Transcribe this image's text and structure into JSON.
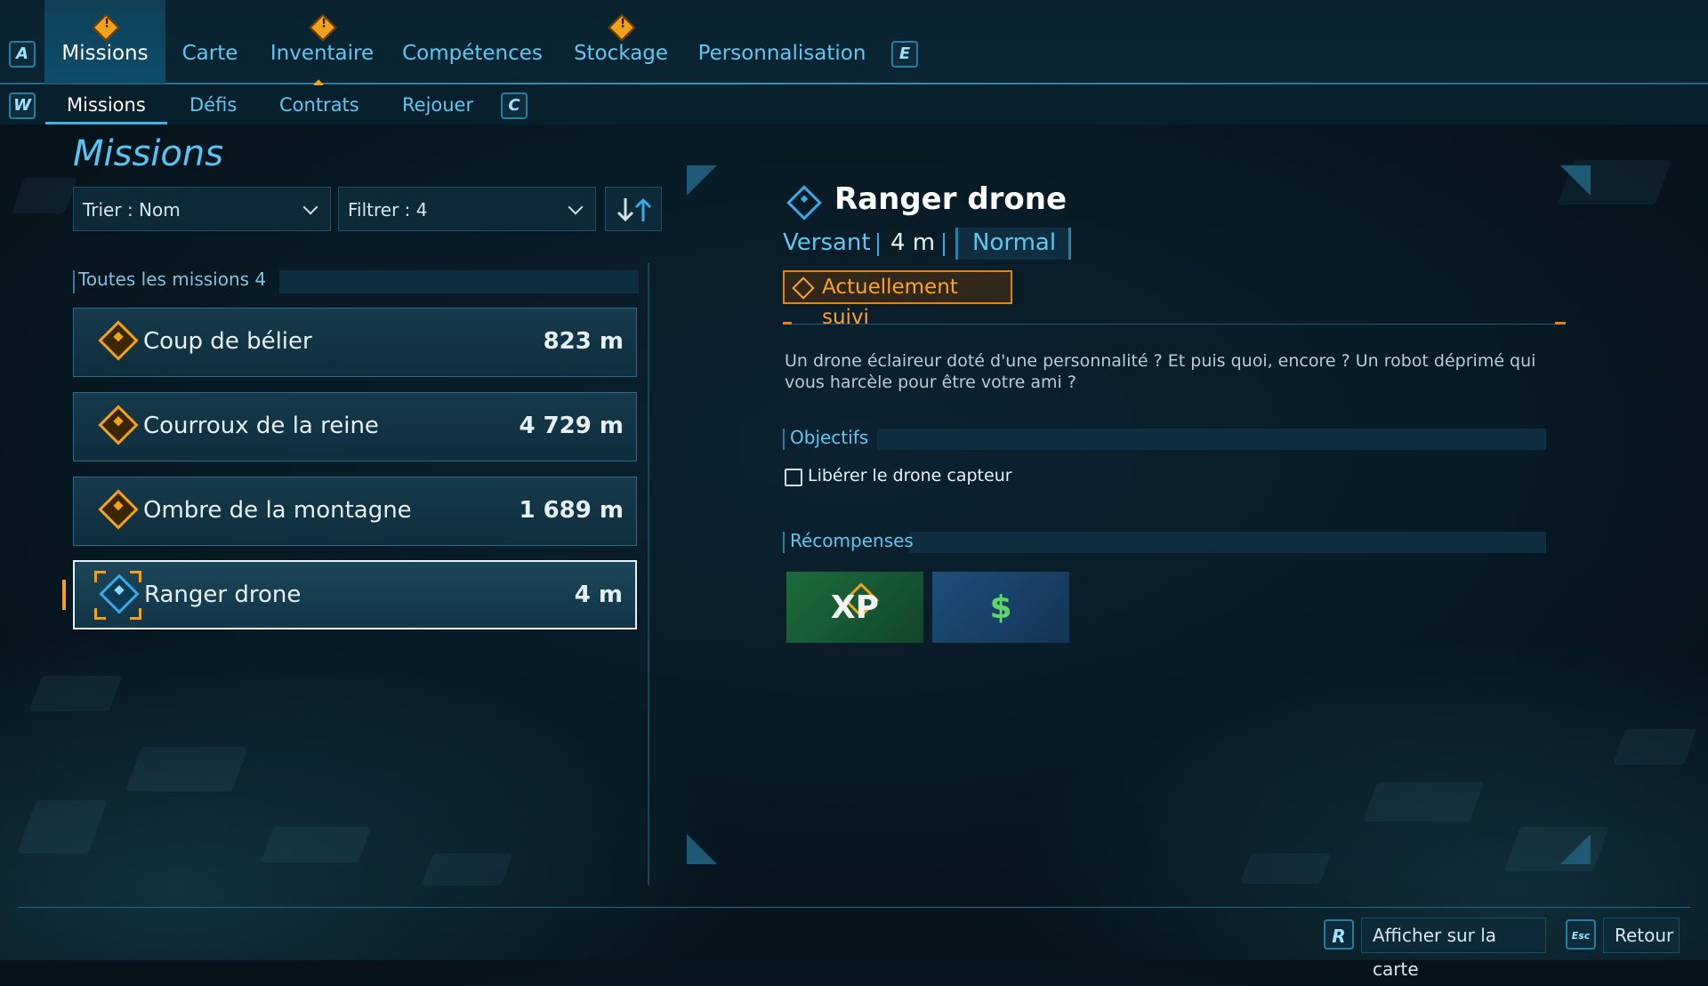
{
  "top_tabs": {
    "left_key": "A",
    "right_key": "E",
    "items": [
      {
        "label": "Missions",
        "active": true,
        "alert": true
      },
      {
        "label": "Carte",
        "active": false,
        "alert": false
      },
      {
        "label": "Inventaire",
        "active": false,
        "alert": true
      },
      {
        "label": "Compétences",
        "active": false,
        "alert": false
      },
      {
        "label": "Stockage",
        "active": false,
        "alert": true
      },
      {
        "label": "Personnalisation",
        "active": false,
        "alert": false
      }
    ]
  },
  "sub_tabs": {
    "left_key": "W",
    "right_key": "C",
    "items": [
      {
        "label": "Missions",
        "active": true
      },
      {
        "label": "Défis",
        "active": false
      },
      {
        "label": "Contrats",
        "active": false
      },
      {
        "label": "Rejouer",
        "active": false
      }
    ]
  },
  "left_panel": {
    "title": "Missions",
    "sort_label": "Trier : Nom",
    "filter_label": "Filtrer : 4",
    "group_label": "Toutes les missions 4",
    "missions": [
      {
        "name": "Coup de bélier",
        "distance": "823 m",
        "icon": "mission-alert-icon",
        "selected": false
      },
      {
        "name": "Courroux de la reine",
        "distance": "4 729 m",
        "icon": "mission-alert-icon",
        "selected": false
      },
      {
        "name": "Ombre de la montagne",
        "distance": "1 689 m",
        "icon": "mission-alert-icon",
        "selected": false
      },
      {
        "name": "Ranger drone",
        "distance": "4 m",
        "icon": "tracked-mission-icon",
        "selected": true
      }
    ]
  },
  "detail": {
    "title": "Ranger drone",
    "location": "Versant",
    "distance": "4 m",
    "difficulty": "Normal",
    "tracked_label": "Actuellement suivi",
    "description": "Un drone éclaireur doté d'une personnalité ? Et puis quoi, encore ? Un robot déprimé qui vous harcèle pour être votre ami ?",
    "objectives_label": "Objectifs",
    "objectives": [
      "Libérer le drone capteur"
    ],
    "rewards_label": "Récompenses",
    "rewards": [
      {
        "label": "XP",
        "icon": "xp-reward-icon"
      },
      {
        "label": "$",
        "icon": "money-reward-icon"
      }
    ]
  },
  "footer": {
    "map_key": "R",
    "map_label": "Afficher sur la carte",
    "back_key": "Esc",
    "back_label": "Retour"
  },
  "colors": {
    "accent_blue": "#5ec8f3",
    "accent_orange": "#f1a21c",
    "tracked_orange": "#ffa12b"
  }
}
